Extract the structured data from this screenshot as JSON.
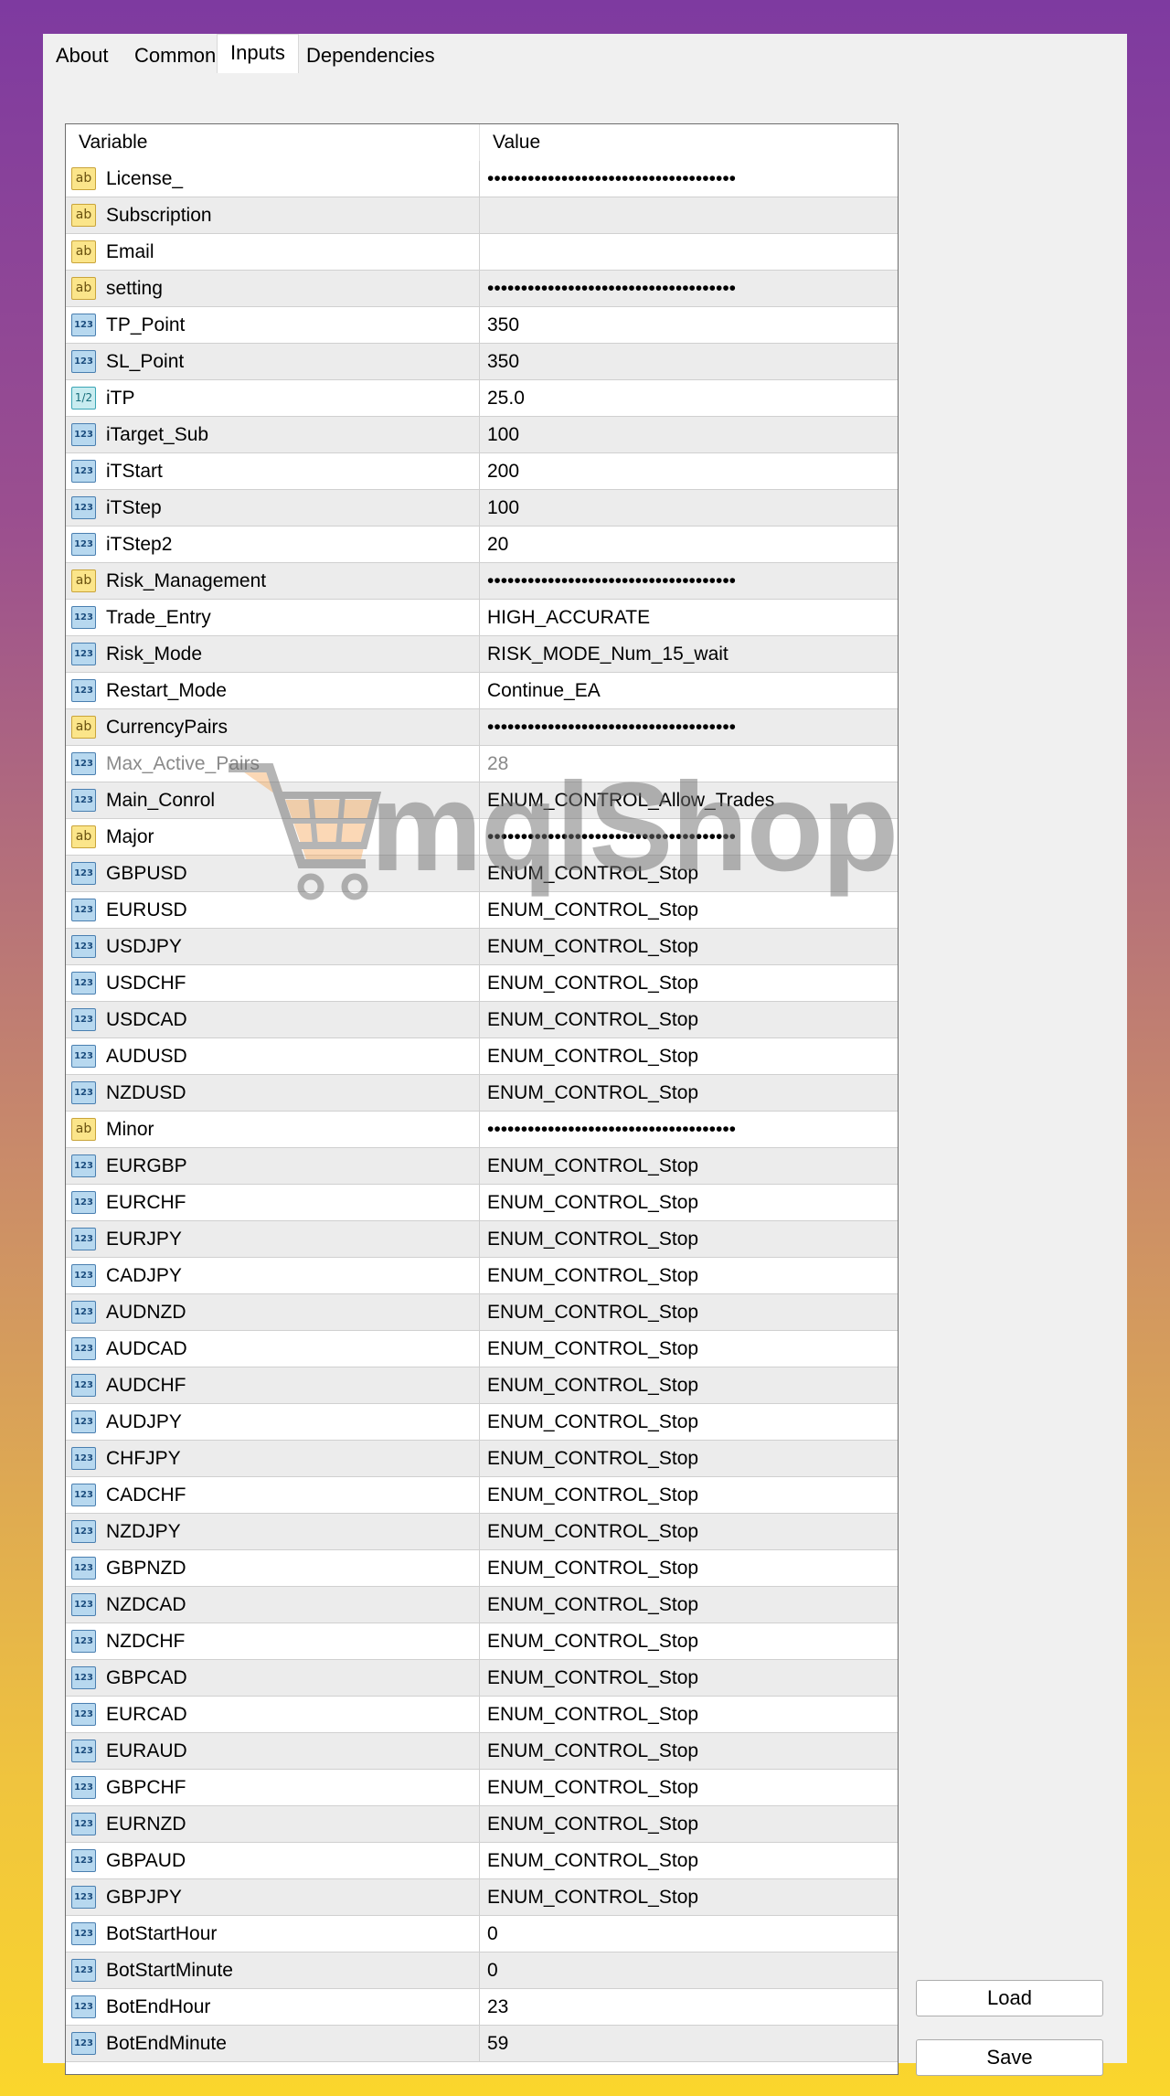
{
  "tabs": [
    {
      "label": "About"
    },
    {
      "label": "Common"
    },
    {
      "label": "Inputs"
    },
    {
      "label": "Dependencies"
    }
  ],
  "active_tab": "Inputs",
  "table": {
    "headers": {
      "variable": "Variable",
      "value": "Value"
    },
    "rows": [
      {
        "icon": "ab",
        "name": "License_",
        "value": "•••••••••••••••••••••••••••••••••••••"
      },
      {
        "icon": "ab",
        "name": "Subscription",
        "value": ""
      },
      {
        "icon": "ab",
        "name": "Email",
        "value": ""
      },
      {
        "icon": "ab",
        "name": "setting",
        "value": "•••••••••••••••••••••••••••••••••••••"
      },
      {
        "icon": "123",
        "name": "TP_Point",
        "value": "350"
      },
      {
        "icon": "123",
        "name": "SL_Point",
        "value": "350"
      },
      {
        "icon": "1/2",
        "name": "iTP",
        "value": "25.0"
      },
      {
        "icon": "123",
        "name": "iTarget_Sub",
        "value": "100"
      },
      {
        "icon": "123",
        "name": "iTStart",
        "value": "200"
      },
      {
        "icon": "123",
        "name": "iTStep",
        "value": "100"
      },
      {
        "icon": "123",
        "name": "iTStep2",
        "value": "20"
      },
      {
        "icon": "ab",
        "name": "Risk_Management",
        "value": "•••••••••••••••••••••••••••••••••••••"
      },
      {
        "icon": "123",
        "name": "Trade_Entry",
        "value": "HIGH_ACCURATE"
      },
      {
        "icon": "123",
        "name": "Risk_Mode",
        "value": "RISK_MODE_Num_15_wait"
      },
      {
        "icon": "123",
        "name": "Restart_Mode",
        "value": "Continue_EA"
      },
      {
        "icon": "ab",
        "name": "CurrencyPairs",
        "value": "•••••••••••••••••••••••••••••••••••••"
      },
      {
        "icon": "123",
        "name": "Max_Active_Pairs",
        "value": "28",
        "dim": true
      },
      {
        "icon": "123",
        "name": "Main_Conrol",
        "value": "ENUM_CONTROL_Allow_Trades"
      },
      {
        "icon": "ab",
        "name": "Major",
        "value": "•••••••••••••••••••••••••••••••••••••"
      },
      {
        "icon": "123",
        "name": "GBPUSD",
        "value": "ENUM_CONTROL_Stop"
      },
      {
        "icon": "123",
        "name": "EURUSD",
        "value": "ENUM_CONTROL_Stop"
      },
      {
        "icon": "123",
        "name": "USDJPY",
        "value": "ENUM_CONTROL_Stop"
      },
      {
        "icon": "123",
        "name": "USDCHF",
        "value": "ENUM_CONTROL_Stop"
      },
      {
        "icon": "123",
        "name": "USDCAD",
        "value": "ENUM_CONTROL_Stop"
      },
      {
        "icon": "123",
        "name": "AUDUSD",
        "value": "ENUM_CONTROL_Stop"
      },
      {
        "icon": "123",
        "name": "NZDUSD",
        "value": "ENUM_CONTROL_Stop"
      },
      {
        "icon": "ab",
        "name": "Minor",
        "value": "•••••••••••••••••••••••••••••••••••••"
      },
      {
        "icon": "123",
        "name": "EURGBP",
        "value": "ENUM_CONTROL_Stop"
      },
      {
        "icon": "123",
        "name": "EURCHF",
        "value": "ENUM_CONTROL_Stop"
      },
      {
        "icon": "123",
        "name": "EURJPY",
        "value": "ENUM_CONTROL_Stop"
      },
      {
        "icon": "123",
        "name": "CADJPY",
        "value": "ENUM_CONTROL_Stop"
      },
      {
        "icon": "123",
        "name": "AUDNZD",
        "value": "ENUM_CONTROL_Stop"
      },
      {
        "icon": "123",
        "name": "AUDCAD",
        "value": "ENUM_CONTROL_Stop"
      },
      {
        "icon": "123",
        "name": "AUDCHF",
        "value": "ENUM_CONTROL_Stop"
      },
      {
        "icon": "123",
        "name": "AUDJPY",
        "value": "ENUM_CONTROL_Stop"
      },
      {
        "icon": "123",
        "name": "CHFJPY",
        "value": "ENUM_CONTROL_Stop"
      },
      {
        "icon": "123",
        "name": "CADCHF",
        "value": "ENUM_CONTROL_Stop"
      },
      {
        "icon": "123",
        "name": "NZDJPY",
        "value": "ENUM_CONTROL_Stop"
      },
      {
        "icon": "123",
        "name": "GBPNZD",
        "value": "ENUM_CONTROL_Stop"
      },
      {
        "icon": "123",
        "name": "NZDCAD",
        "value": "ENUM_CONTROL_Stop"
      },
      {
        "icon": "123",
        "name": "NZDCHF",
        "value": "ENUM_CONTROL_Stop"
      },
      {
        "icon": "123",
        "name": "GBPCAD",
        "value": "ENUM_CONTROL_Stop"
      },
      {
        "icon": "123",
        "name": "EURCAD",
        "value": "ENUM_CONTROL_Stop"
      },
      {
        "icon": "123",
        "name": "EURAUD",
        "value": "ENUM_CONTROL_Stop"
      },
      {
        "icon": "123",
        "name": "GBPCHF",
        "value": "ENUM_CONTROL_Stop"
      },
      {
        "icon": "123",
        "name": "EURNZD",
        "value": "ENUM_CONTROL_Stop"
      },
      {
        "icon": "123",
        "name": "GBPAUD",
        "value": "ENUM_CONTROL_Stop"
      },
      {
        "icon": "123",
        "name": "GBPJPY",
        "value": "ENUM_CONTROL_Stop"
      },
      {
        "icon": "123",
        "name": "BotStartHour",
        "value": "0"
      },
      {
        "icon": "123",
        "name": "BotStartMinute",
        "value": "0"
      },
      {
        "icon": "123",
        "name": "BotEndHour",
        "value": "23"
      },
      {
        "icon": "123",
        "name": "BotEndMinute",
        "value": "59"
      }
    ]
  },
  "buttons": {
    "load": "Load",
    "save": "Save"
  },
  "watermark": {
    "text": "mqlShop",
    "icon": "shopping-cart-icon"
  },
  "colors": {
    "bg_top": "#7e3aa0",
    "bg_bottom": "#fad62c",
    "string_icon": "#fbe58a",
    "int_icon": "#b7d8ef",
    "double_icon": "#c8ecf0",
    "watermark_cart": "#f5a04a"
  }
}
